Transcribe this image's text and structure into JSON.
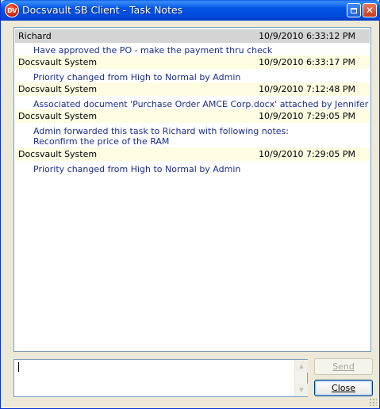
{
  "window": {
    "title": "Docsvault SB Client - Task Notes",
    "icon_text": "DV",
    "maximize_icon": "maximize-icon",
    "close_icon": "close-icon"
  },
  "notes": [
    {
      "author": "Richard",
      "datetime": "10/9/2010 6:33:12 PM",
      "text": "Have approved the PO - make the payment thru check"
    },
    {
      "author": "Docsvault System",
      "datetime": "10/9/2010 6:33:17 PM",
      "text": "Priority changed from High to Normal by Admin"
    },
    {
      "author": "Docsvault System",
      "datetime": "10/9/2010 7:12:48 PM",
      "text": "Associated document 'Purchase Order AMCE Corp.docx' attached by Jennifer"
    },
    {
      "author": "Docsvault System",
      "datetime": "10/9/2010 7:29:05 PM",
      "text": "Admin forwarded this task to Richard with following notes:\nReconfirm the price of the RAM"
    },
    {
      "author": "Docsvault System",
      "datetime": "10/9/2010 7:29:05 PM",
      "text": "Priority changed from High to Normal by Admin"
    }
  ],
  "compose": {
    "value": ""
  },
  "buttons": {
    "send": "Send",
    "close": "Close"
  },
  "colors": {
    "title_bar": "#0255e3",
    "selected_header": "#d4d4d4",
    "header_row": "#fffde1",
    "note_text": "#1c2e8a"
  }
}
